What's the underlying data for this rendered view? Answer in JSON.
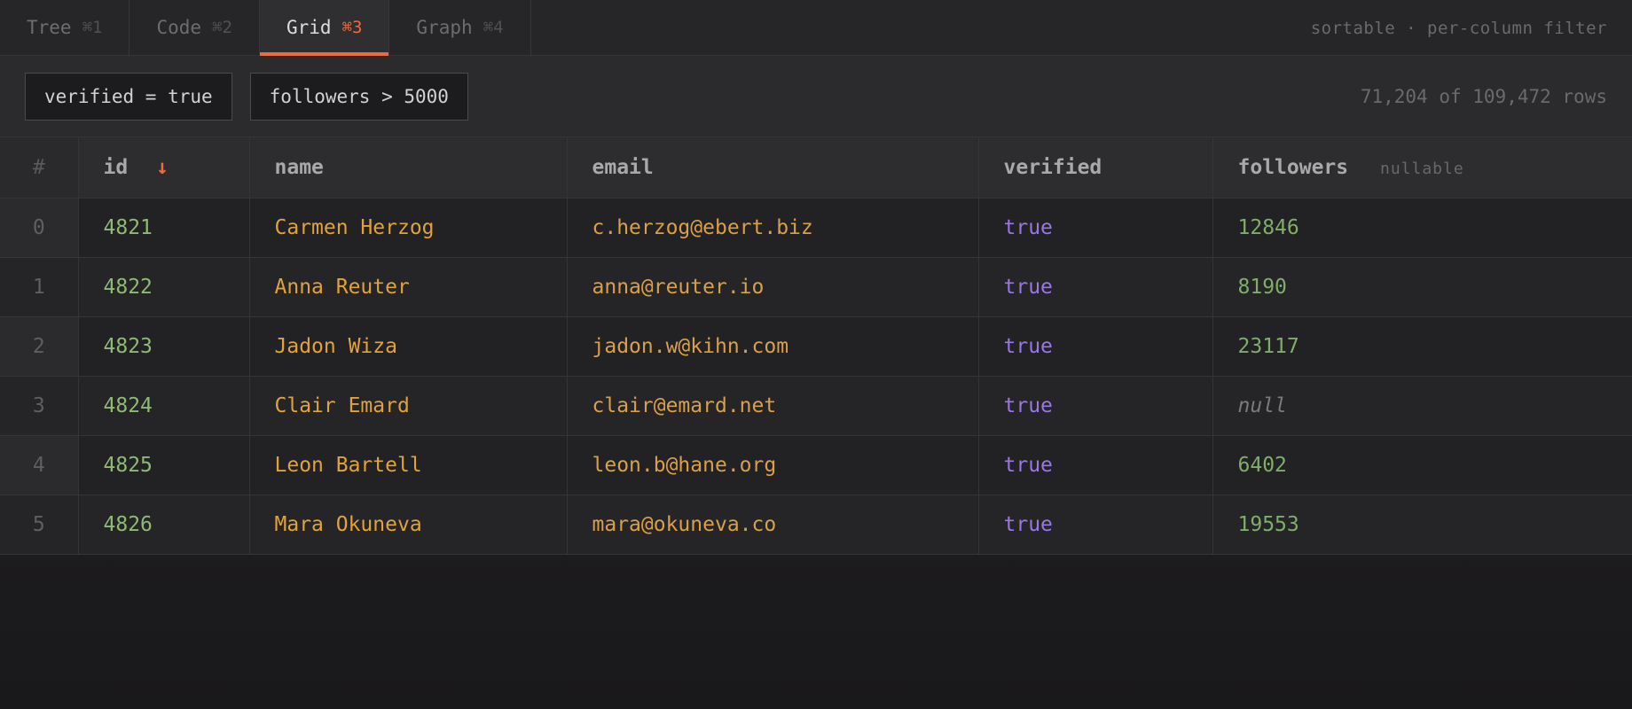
{
  "tabs": [
    {
      "label": "Tree",
      "shortcut": "⌘1",
      "active": false
    },
    {
      "label": "Code",
      "shortcut": "⌘2",
      "active": false
    },
    {
      "label": "Grid",
      "shortcut": "⌘3",
      "active": true
    },
    {
      "label": "Graph",
      "shortcut": "⌘4",
      "active": false
    }
  ],
  "tab_meta": "sortable · per-column filter",
  "filters": [
    "verified = true",
    "followers > 5000"
  ],
  "row_count": "71,204 of 109,472 rows",
  "columns": {
    "index": "#",
    "id": "id",
    "sort_indicator": "↓",
    "name": "name",
    "email": "email",
    "verified": "verified",
    "followers": "followers",
    "followers_note": "nullable"
  },
  "rows": [
    {
      "index": "0",
      "id": "4821",
      "name": "Carmen Herzog",
      "email": "c.herzog@ebert.biz",
      "verified": "true",
      "followers": "12846"
    },
    {
      "index": "1",
      "id": "4822",
      "name": "Anna Reuter",
      "email": "anna@reuter.io",
      "verified": "true",
      "followers": "8190"
    },
    {
      "index": "2",
      "id": "4823",
      "name": "Jadon Wiza",
      "email": "jadon.w@kihn.com",
      "verified": "true",
      "followers": "23117"
    },
    {
      "index": "3",
      "id": "4824",
      "name": "Clair Emard",
      "email": "clair@emard.net",
      "verified": "true",
      "followers": "null"
    },
    {
      "index": "4",
      "id": "4825",
      "name": "Leon Bartell",
      "email": "leon.b@hane.org",
      "verified": "true",
      "followers": "6402"
    },
    {
      "index": "5",
      "id": "4826",
      "name": "Mara Okuneva",
      "email": "mara@okuneva.co",
      "verified": "true",
      "followers": "19553"
    }
  ],
  "colors": {
    "accent": "#ef6a3c",
    "id": "#8fba75",
    "string": "#e0a33c",
    "boolean": "#9a76e6",
    "number": "#7fae6a",
    "null": "#7a797c"
  }
}
